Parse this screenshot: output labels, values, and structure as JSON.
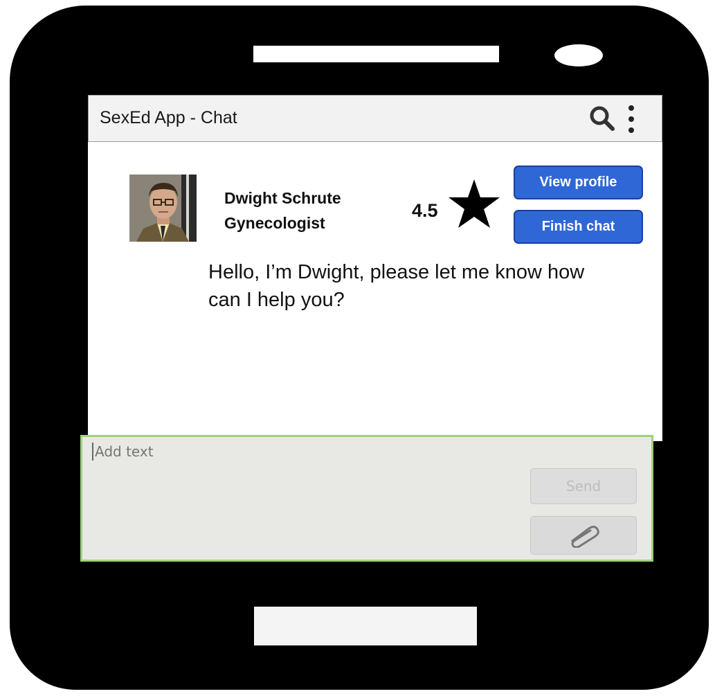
{
  "app_bar": {
    "title": "SexEd App - Chat",
    "icons": [
      "search-icon",
      "more-vertical-icon"
    ]
  },
  "doctor": {
    "name": "Dwight Schrute",
    "specialty": "Gynecologist",
    "rating": "4.5",
    "rating_icon": "star-icon"
  },
  "actions": {
    "view_profile": "View profile",
    "finish_chat": "Finish chat"
  },
  "chat": {
    "message": "Hello, I’m Dwight, please let me know how can I help you?"
  },
  "composer": {
    "placeholder": "Add text",
    "send_label": "Send",
    "attach_icon": "paperclip-icon"
  },
  "colors": {
    "button_blue": "#2f68d6",
    "composer_border": "#9fd07f"
  }
}
